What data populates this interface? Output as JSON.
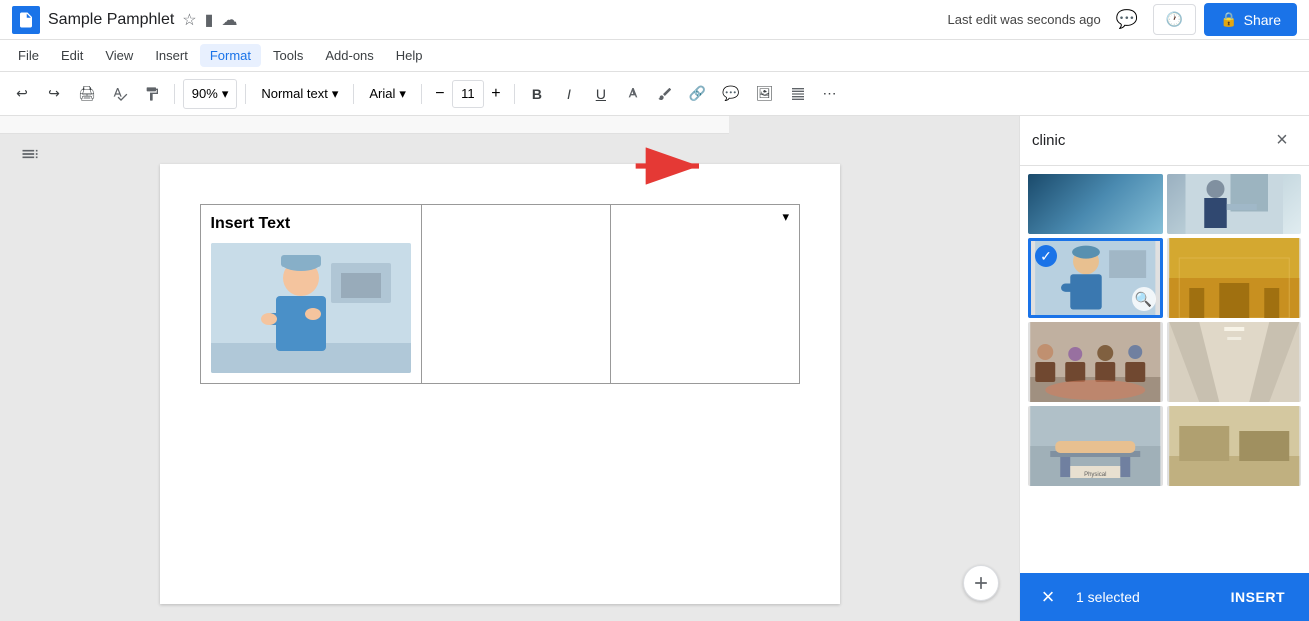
{
  "title_bar": {
    "app_name": "Sample Pamphlet",
    "star_icon": "★",
    "folder_icon": "📁",
    "cloud_icon": "☁",
    "comments_icon": "💬",
    "share_label": "Share",
    "history_icon": "🕐"
  },
  "menu": {
    "items": [
      "File",
      "Edit",
      "View",
      "Insert",
      "Format",
      "Tools",
      "Add-ons",
      "Help"
    ],
    "active": "Format",
    "last_edit": "Last edit was seconds ago"
  },
  "toolbar": {
    "zoom": "90%",
    "text_style": "Normal text",
    "font": "Arial",
    "font_size": "11",
    "undo_icon": "↩",
    "redo_icon": "↪",
    "print_icon": "🖨",
    "paint_icon": "🎨",
    "pointer_icon": "↖",
    "minus_icon": "−",
    "plus_icon": "+",
    "bold_icon": "B",
    "italic_icon": "I",
    "underline_icon": "U",
    "more_icon": "⋯"
  },
  "document": {
    "insert_text": "Insert Text"
  },
  "image_panel": {
    "search_value": "clinic",
    "close_icon": "×",
    "images": [
      {
        "id": 1,
        "class": "thumb-1",
        "selected": false,
        "label": "clinic image 1"
      },
      {
        "id": 2,
        "class": "thumb-2",
        "selected": false,
        "label": "clinic image 2"
      },
      {
        "id": 3,
        "class": "thumb-3",
        "selected": true,
        "label": "clinic doctor selected"
      },
      {
        "id": 4,
        "class": "thumb-4",
        "selected": false,
        "label": "clinic image 4"
      },
      {
        "id": 5,
        "class": "thumb-5",
        "selected": false,
        "label": "clinic image 5"
      },
      {
        "id": 6,
        "class": "thumb-6",
        "selected": false,
        "label": "clinic image 6"
      },
      {
        "id": 7,
        "class": "thumb-7",
        "selected": false,
        "label": "clinic physical"
      },
      {
        "id": 8,
        "class": "thumb-8",
        "selected": false,
        "label": "clinic image 8"
      }
    ]
  },
  "bottom_bar": {
    "selected_count": "1 selected",
    "insert_label": "INSERT",
    "cancel_icon": "×"
  }
}
